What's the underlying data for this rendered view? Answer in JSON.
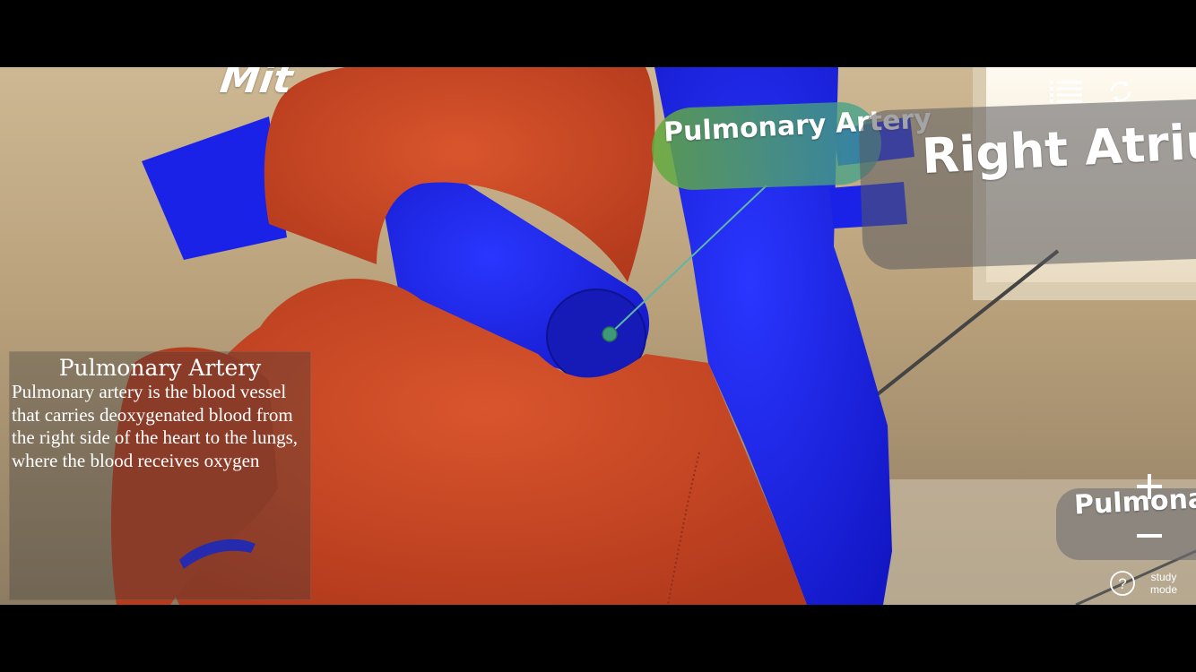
{
  "scene": {
    "labels": {
      "mitral": "Mit",
      "pulmonary_artery": "Pulmonary Artery",
      "right_atrium": "Right Atrium",
      "pulmonary_partial": "Pulmonary"
    },
    "colors": {
      "aorta_red": "#cc4a25",
      "vein_blue": "#1a22f0",
      "pill_green": "#6aaa3c"
    }
  },
  "info_panel": {
    "title": "Pulmonary Artery",
    "description": "Pulmonary artery is the blood vessel that carries deoxygenated blood from the right side of the heart to the lungs, where the blood receives oxygen"
  },
  "controls": {
    "menu_icon": "list-icon",
    "refresh_icon": "refresh-icon",
    "zoom_in_icon": "plus-icon",
    "zoom_out_icon": "minus-icon",
    "help_icon": "question-circle-icon",
    "study_mode_label": "study mode"
  }
}
